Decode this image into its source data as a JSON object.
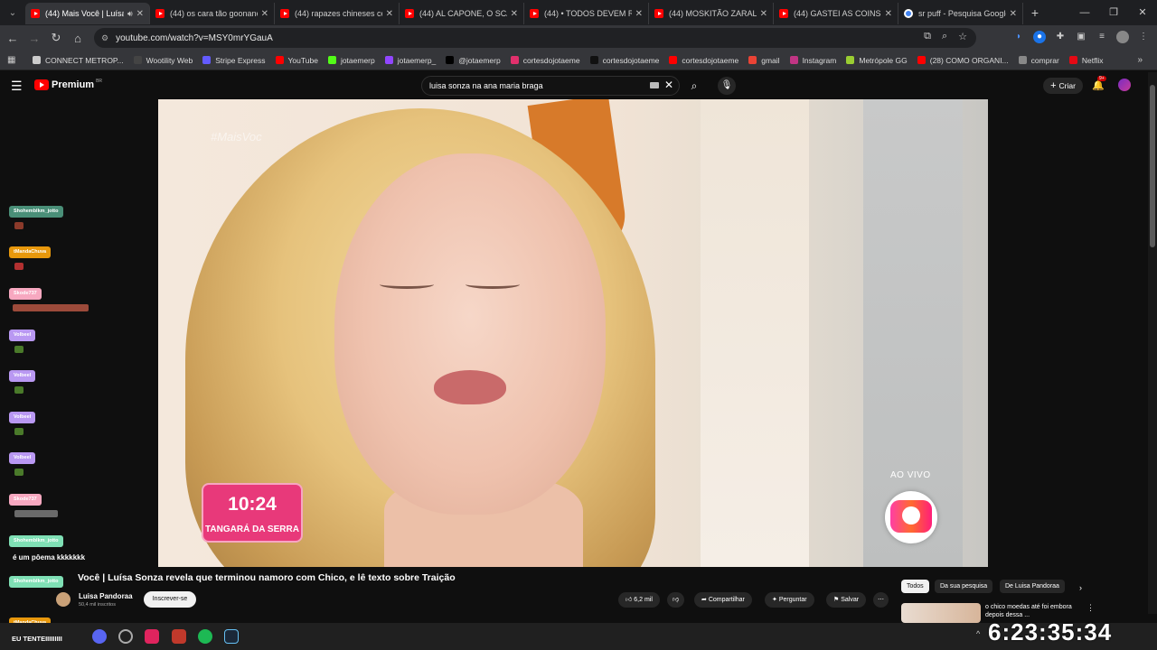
{
  "browser": {
    "tabs": [
      {
        "title": "(44) Mais Você | Luísa",
        "active": true,
        "audio": true,
        "icon": "youtube-icon"
      },
      {
        "title": "(44) os cara tão goonano",
        "icon": "youtube-icon"
      },
      {
        "title": "(44) rapazes chineses cob",
        "icon": "youtube-icon"
      },
      {
        "title": "(44) AL CAPONE, O SCARF",
        "icon": "youtube-icon"
      },
      {
        "title": "(44) • TODOS DEVEM R",
        "icon": "youtube-icon"
      },
      {
        "title": "(44) MOSKITÃO ZARALHA",
        "icon": "youtube-icon"
      },
      {
        "title": "(44) GASTEI AS COINS DO",
        "icon": "youtube-icon"
      },
      {
        "title": "sr puff - Pesquisa Google",
        "icon": "google-icon"
      }
    ],
    "url": "youtube.com/watch?v=MSY0mrYGauA",
    "bookmarks": [
      {
        "label": "CONNECT METROP...",
        "color": "#cccccc"
      },
      {
        "label": "Wootility Web",
        "color": "#444444"
      },
      {
        "label": "Stripe Express",
        "color": "#635bff"
      },
      {
        "label": "YouTube",
        "color": "#ff0000"
      },
      {
        "label": "jotaemerp",
        "color": "#53fc18"
      },
      {
        "label": "jotaemerp_",
        "color": "#9146ff"
      },
      {
        "label": "@jotaemerp",
        "color": "#000000"
      },
      {
        "label": "cortesdojotaeme",
        "color": "#e1306c"
      },
      {
        "label": "cortesdojotaeme",
        "color": "#111111"
      },
      {
        "label": "cortesdojotaeme",
        "color": "#ff0000"
      },
      {
        "label": "gmail",
        "color": "#ea4335"
      },
      {
        "label": "Instagram",
        "color": "#c13584"
      },
      {
        "label": "Metrópole GG",
        "color": "#9acd32"
      },
      {
        "label": "(28) COMO ORGANI...",
        "color": "#ff0000"
      },
      {
        "label": "comprar",
        "color": "#888888"
      },
      {
        "label": "Netflix",
        "color": "#e50914"
      }
    ]
  },
  "youtube": {
    "logo_text": "Premium",
    "logo_sup": "BR",
    "search_query": "luisa sonza na ana maria braga",
    "create_label": "Criar",
    "notif_badge": "9+"
  },
  "video": {
    "watermark": "#MaisVoc",
    "clock_time": "10:24",
    "clock_city": "TANGARÁ DA SERRA",
    "live_label": "AO VIVO",
    "title": "Você | Luísa Sonza revela que terminou namoro com Chico, e lê texto sobre Traição",
    "channel": "Luisa Pandoraa",
    "subscribers": "50,4 mil inscritos",
    "subscribe_label": "Inscrever-se",
    "likes": "6,2 mil",
    "share_label": "Compartilhar",
    "ask_label": "Perguntar",
    "save_label": "Salvar"
  },
  "side": {
    "chips": [
      "Todos",
      "Da sua pesquisa",
      "De Luisa Pandoraa"
    ],
    "rec_title": "o chico moedas até foi embora depois dessa ..."
  },
  "chat": {
    "chips": [
      {
        "name": "Shohemblkm_jotto",
        "color": "#4a8f78"
      },
      {
        "name": "tMandaChuva",
        "color": "#e8980c"
      },
      {
        "name": "Skode737",
        "color": "#f7a8c0"
      },
      {
        "name": "Volbeel",
        "color": "#b998f2"
      },
      {
        "name": "Volbeel",
        "color": "#b998f2"
      },
      {
        "name": "Volbeel",
        "color": "#b998f2"
      },
      {
        "name": "Volbeel",
        "color": "#b998f2"
      },
      {
        "name": "Skode737",
        "color": "#f7a8c0"
      },
      {
        "name": "Shohemblkm_jotto",
        "color": "#7fe0b5"
      },
      {
        "name": "Shohemblkm_jotto",
        "color": "#7fe0b5"
      },
      {
        "name": "tMandaChuva",
        "color": "#e8980c"
      }
    ],
    "message": "é um pôema kkkkkkk",
    "footer_text": "EU TENTEIIIIIIIII"
  },
  "taskbar": {
    "clock": "6:23:35:34"
  }
}
